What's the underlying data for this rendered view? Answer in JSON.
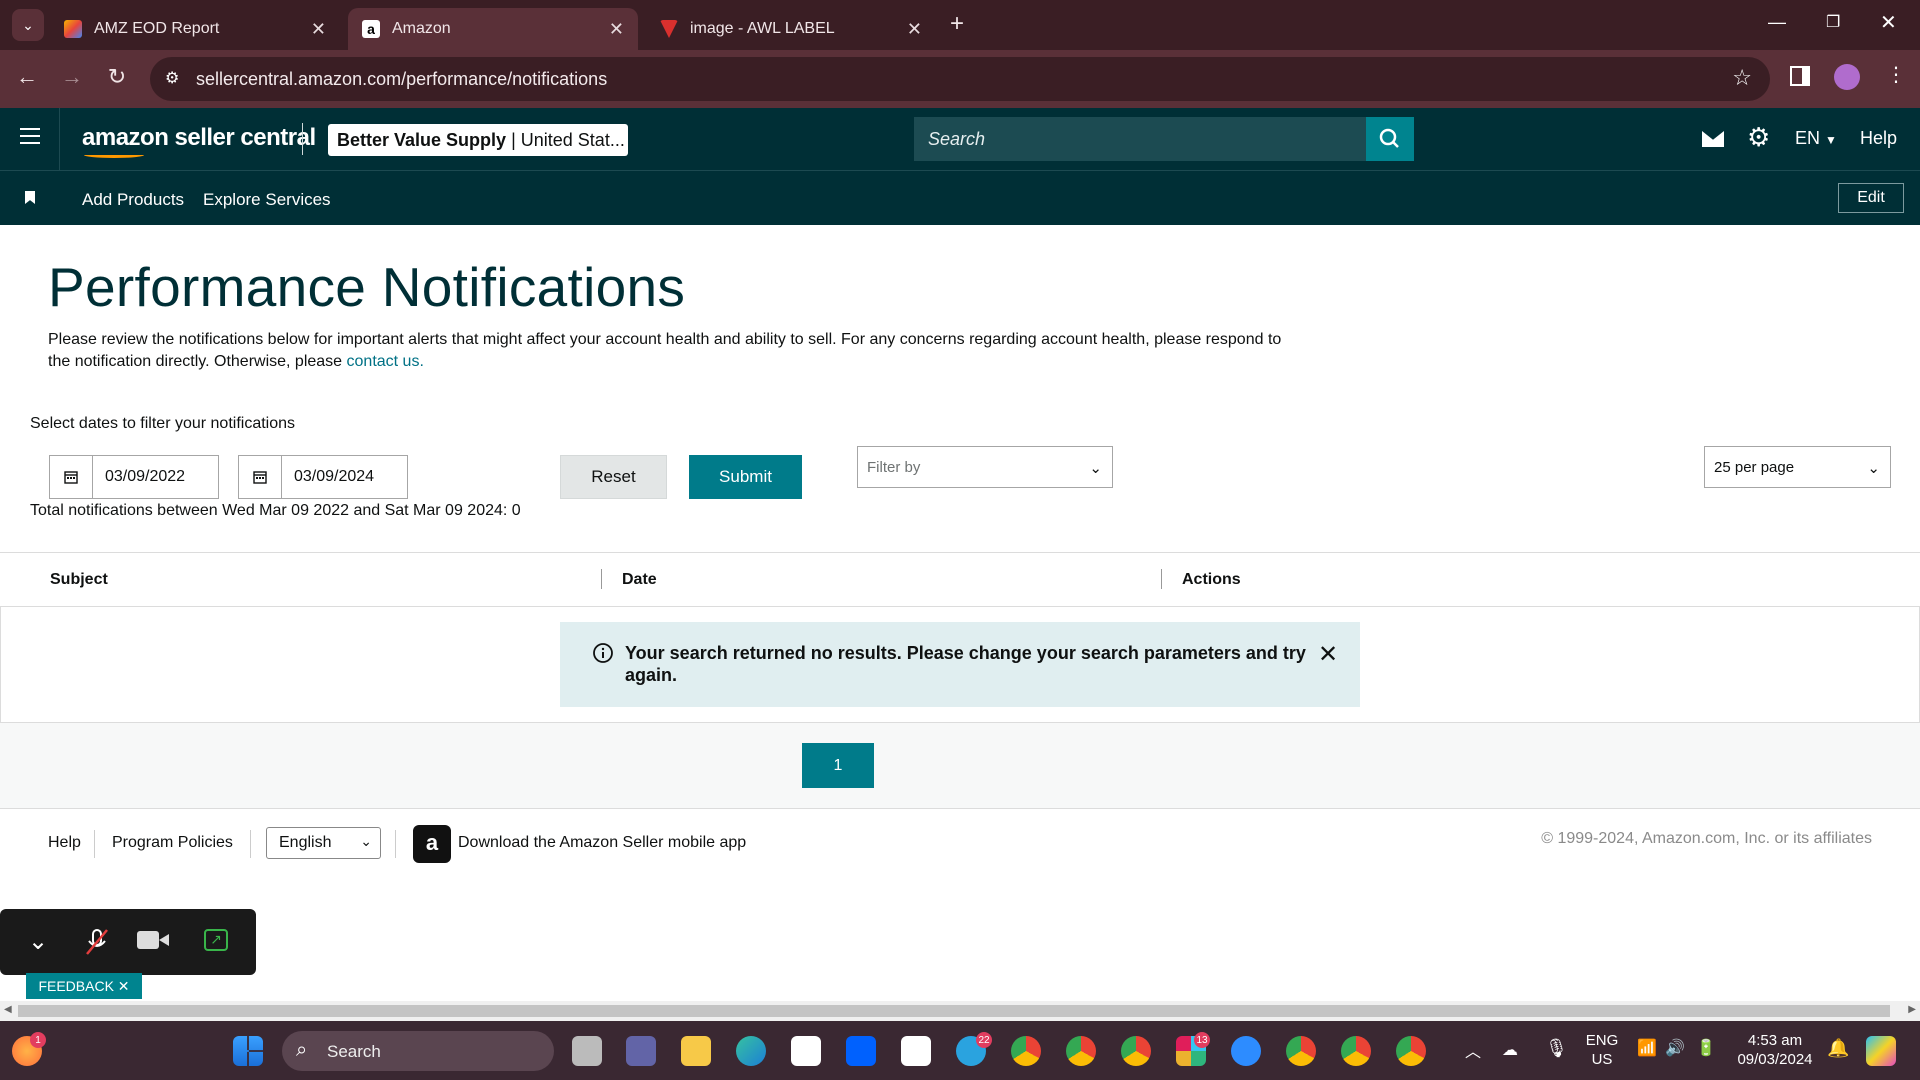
{
  "browser": {
    "tabs": [
      {
        "title": "AMZ EOD Report",
        "active": false
      },
      {
        "title": "Amazon",
        "active": true
      },
      {
        "title": "image - AWL LABEL",
        "active": false
      }
    ],
    "url": "sellercentral.amazon.com/performance/notifications"
  },
  "header": {
    "logo": "amazon seller central",
    "store_name": "Better Value Supply",
    "store_region": "United Stat...",
    "search_placeholder": "Search",
    "language": "EN",
    "help": "Help"
  },
  "subnav": {
    "items": [
      "Add Products",
      "Explore Services"
    ],
    "edit": "Edit"
  },
  "main": {
    "title": "Performance Notifications",
    "intro": "Please review the notifications below for important alerts that might affect your account health and ability to sell. For any concerns regarding account health, please respond to the notification directly. Otherwise, please ",
    "contact_link": "contact us.",
    "filter_label": "Select dates to filter your notifications",
    "date_from": "03/09/2022",
    "date_to": "03/09/2024",
    "reset_label": "Reset",
    "submit_label": "Submit",
    "filter_by": "Filter by",
    "per_page": "25 per page",
    "total_text": "Total notifications between Wed Mar 09 2022 and Sat Mar 09 2024: 0",
    "columns": [
      "Subject",
      "Date",
      "Actions"
    ],
    "alert": "Your search returned no results. Please change your search parameters and try again.",
    "page": "1"
  },
  "footer": {
    "help": "Help",
    "program_policies": "Program Policies",
    "language": "English",
    "app_link": "Download the Amazon Seller mobile app",
    "copyright": "© 1999-2024, Amazon.com, Inc. or its affiliates"
  },
  "overlay": {
    "feedback": "FEEDBACK ✕"
  },
  "taskbar": {
    "search": "Search",
    "lang_top": "ENG",
    "lang_bottom": "US",
    "time": "4:53 am",
    "date": "09/03/2024",
    "badges": {
      "telegram": "22",
      "slack": "13"
    }
  },
  "colors": {
    "header_bg": "#002f36",
    "accent": "#007b8a",
    "alert_bg": "#e0eef0",
    "browser_bg": "#3a1e24"
  }
}
